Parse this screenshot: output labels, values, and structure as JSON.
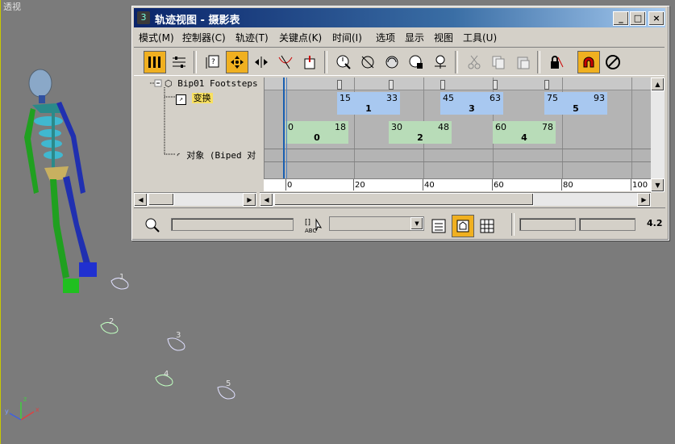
{
  "viewport": {
    "label": "透视",
    "footstep_numbers": [
      "1",
      "2",
      "3",
      "4",
      "5"
    ]
  },
  "window": {
    "title": "轨迹视图 - 摄影表",
    "buttons": {
      "minimize": "_",
      "maximize": "□",
      "close": "×"
    }
  },
  "menu": [
    "模式(M)",
    "控制器(C)",
    "轨迹(T)",
    "关键点(K)",
    "时间(I)",
    "选项",
    "显示",
    "视图",
    "工具(U)"
  ],
  "tree": {
    "root": "Bip01 Footsteps",
    "transform": "变换",
    "object": "对象 (Biped 对"
  },
  "tracks": {
    "top_blocks": [
      {
        "start": "15",
        "end": "33",
        "num": "1"
      },
      {
        "start": "45",
        "end": "63",
        "num": "3"
      },
      {
        "start": "75",
        "end": "93",
        "num": "5"
      }
    ],
    "bottom_blocks": [
      {
        "start": "0",
        "end": "18",
        "num": "0"
      },
      {
        "start": "30",
        "end": "48",
        "num": "2"
      },
      {
        "start": "60",
        "end": "78",
        "num": "4"
      }
    ],
    "colors": {
      "top": "#a8c8f0",
      "bottom": "#b8dcb8"
    }
  },
  "ruler": [
    "0",
    "20",
    "40",
    "60",
    "80",
    "100"
  ],
  "status": {
    "partial_value": "4.2"
  }
}
